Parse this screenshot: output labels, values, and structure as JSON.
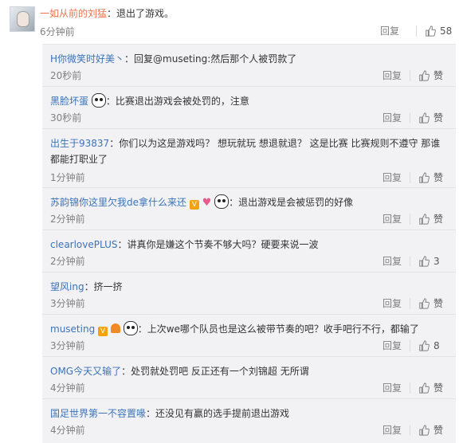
{
  "top": {
    "user": "一如从前的刘猛",
    "text": "：退出了游戏。",
    "time": "6分钟前",
    "reply": "回复",
    "likes": "58"
  },
  "comments": [
    {
      "user": "H你微笑时好美丶",
      "text": "：回复@museting:然后那个人被罚款了",
      "time": "20秒前",
      "reply": "回复",
      "like_label": "赞"
    },
    {
      "user": "黑脸坏蛋",
      "text": "：比赛退出游戏会被处罚的，注意",
      "time": "30秒前",
      "reply": "回复",
      "like_label": "赞"
    },
    {
      "user": "出生于93837",
      "text": "：你们以为这是游戏吗？ 想玩就玩 想退就退？  这是比赛 比赛规则不遵守 那谁都能打职业了",
      "time": "1分钟前",
      "reply": "回复",
      "like_label": "赞"
    },
    {
      "user": "苏韵锦你这里欠我de拿什么来还",
      "text": "：退出游戏是会被惩罚的好像",
      "time": "2分钟前",
      "reply": "回复",
      "like_label": "赞"
    },
    {
      "user": "clearlovePLUS",
      "text": "：讲真你是嫌这个节奏不够大吗？硬要来说一波",
      "time": "2分钟前",
      "reply": "回复",
      "likes": "3"
    },
    {
      "user": "望风ing",
      "text": "：挤一挤",
      "time": "3分钟前",
      "reply": "回复",
      "like_label": "赞"
    },
    {
      "user": "museting",
      "text": "：上次we哪个队员也是这么被带节奏的吧？收手吧行不行，都输了",
      "time": "3分钟前",
      "reply": "回复",
      "likes": "8"
    },
    {
      "user": "OMG今天又输了",
      "text": "：处罚就处罚吧 反正还有一个刘锦超  无所谓",
      "time": "4分钟前",
      "reply": "回复",
      "like_label": "赞"
    },
    {
      "user": "国足世界第一不容置喙",
      "text": "：还没见有赢的选手提前退出游戏",
      "time": "4分钟前",
      "reply": "回复",
      "like_label": "赞"
    }
  ],
  "colors": {
    "username_top": "#eb7350",
    "username_sub": "#3b73b9",
    "sub_bg": "#f2f2f5"
  },
  "icons": [
    "thumb-up-icon",
    "panda-emoji-icon",
    "vip-badge-icon",
    "heart-badge-icon"
  ]
}
